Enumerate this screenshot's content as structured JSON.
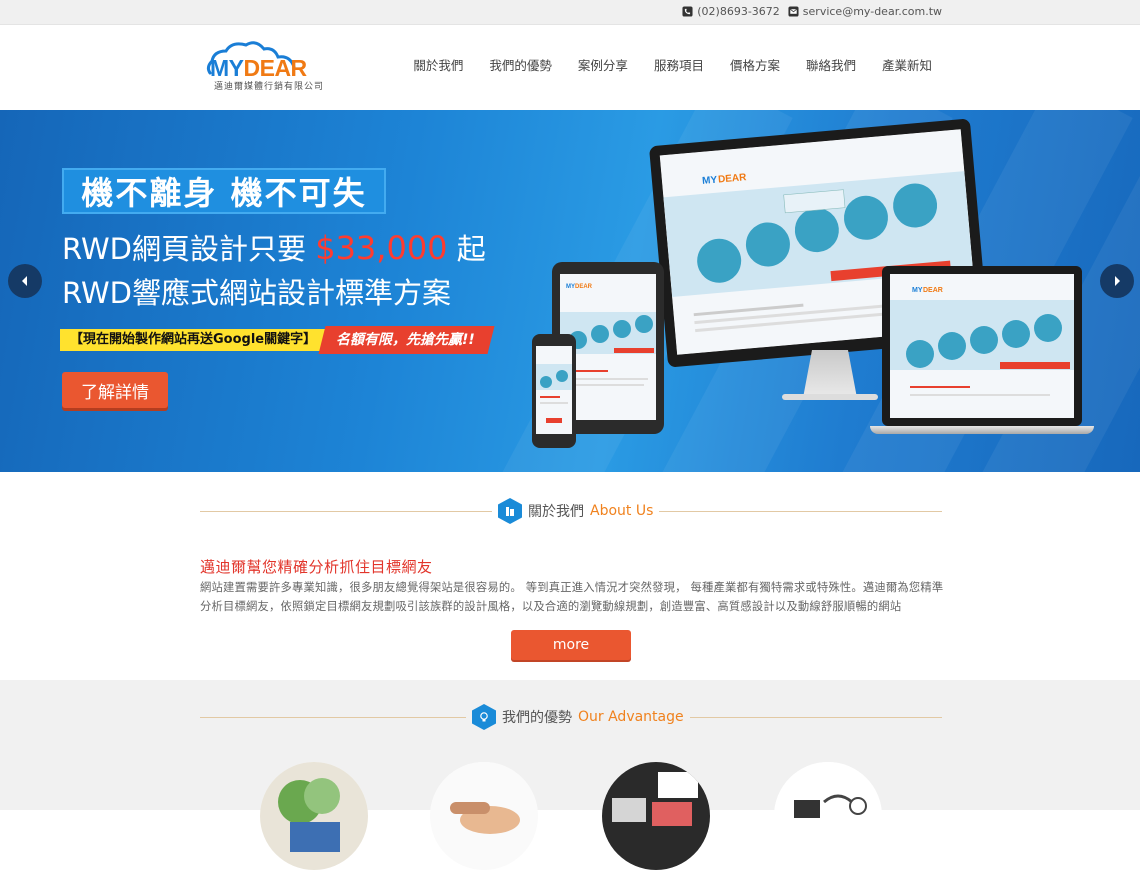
{
  "topbar": {
    "phone": "(02)8693-3672",
    "email": "service@my-dear.com.tw"
  },
  "header": {
    "logo_my": "MY",
    "logo_dear": "DEAR",
    "logo_sub": "邁迪爾媒體行銷有限公司",
    "nav": [
      "關於我們",
      "我們的優勢",
      "案例分享",
      "服務項目",
      "價格方案",
      "聯絡我們",
      "產業新知"
    ]
  },
  "hero": {
    "badge": "機不離身  機不可失",
    "line1_prefix": "RWD網頁設計只要 ",
    "line1_price": "$33,000",
    "line1_suffix": " 起",
    "line2": "RWD響應式網站設計標準方案",
    "promo_yellow": "【現在開始製作網站再送Google關鍵字】",
    "promo_red": "名額有限，先搶先贏!!",
    "button": "了解詳情"
  },
  "about": {
    "title_zh": "關於我們",
    "title_en": "About Us",
    "heading": "邁迪爾幫您精確分析抓住目標網友",
    "body": "網站建置需要許多專業知識，很多朋友總覺得架站是很容易的。 等到真正進入情況才突然發現， 每種產業都有獨特需求或特殊性。邁迪爾為您精準分析目標網友，依照鎖定目標網友規劃吸引該族群的設計風格，以及合適的瀏覽動線規劃，創造豐富、高質感設計以及動線舒服順暢的網站",
    "more": "more"
  },
  "advantage": {
    "title_zh": "我們的優勢",
    "title_en": "Our Advantage"
  },
  "colors": {
    "accent_orange": "#f0821e",
    "button_red": "#ea5730",
    "brand_blue": "#1a7ed6",
    "price_red": "#ff3b2f"
  }
}
